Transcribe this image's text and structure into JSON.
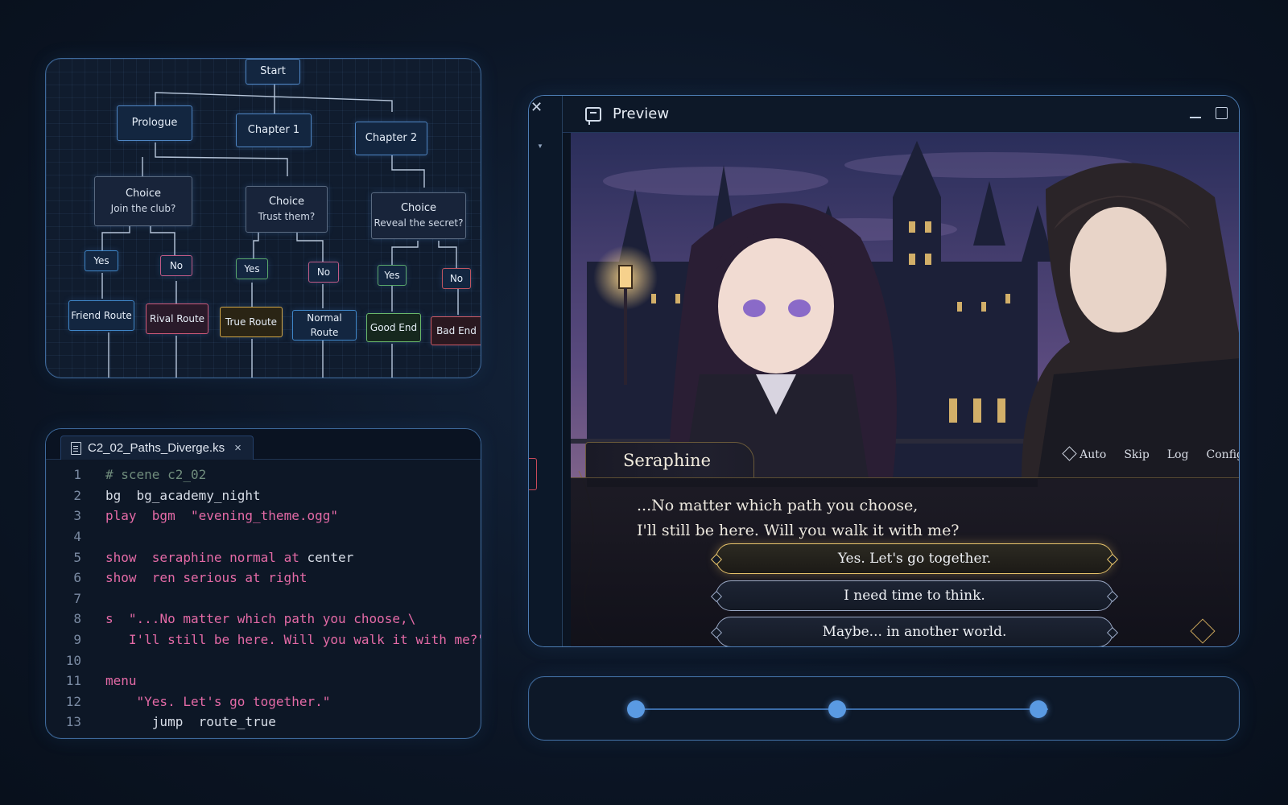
{
  "flowchart": {
    "start": "Start",
    "chapters": [
      "Prologue",
      "Chapter 1",
      "Chapter 2"
    ],
    "choices": [
      {
        "title": "Choice",
        "question": "Join the club?"
      },
      {
        "title": "Choice",
        "question": "Trust them?"
      },
      {
        "title": "Choice",
        "question": "Reveal the secret?"
      }
    ],
    "answers": [
      "Yes",
      "No",
      "Yes",
      "No",
      "Yes",
      "No"
    ],
    "routes": [
      "Friend Route",
      "Rival Route",
      "True Route",
      "Normal Route",
      "Good End",
      "Bad End"
    ]
  },
  "editor": {
    "tab_name": "C2_02_Paths_Diverge.ks",
    "close_glyph": "×",
    "lines": [
      {
        "n": "1",
        "parts": [
          [
            "c-comment",
            "# scene c2_02"
          ]
        ]
      },
      {
        "n": "2",
        "parts": [
          [
            "c-plain",
            "bg  bg_academy_night"
          ]
        ]
      },
      {
        "n": "3",
        "parts": [
          [
            "c-kw",
            "play  bgm  "
          ],
          [
            "c-str2",
            "\"evening_theme.ogg\""
          ]
        ]
      },
      {
        "n": "4",
        "parts": [
          [
            "c-plain",
            ""
          ]
        ]
      },
      {
        "n": "5",
        "parts": [
          [
            "c-kw",
            "show  "
          ],
          [
            "c-str2",
            "seraphine normal "
          ],
          [
            "c-kw",
            "at "
          ],
          [
            "c-plain",
            "center"
          ]
        ]
      },
      {
        "n": "6",
        "parts": [
          [
            "c-kw",
            "show  "
          ],
          [
            "c-str2",
            "ren serious at right"
          ]
        ]
      },
      {
        "n": "7",
        "parts": [
          [
            "c-plain",
            ""
          ]
        ]
      },
      {
        "n": "8",
        "parts": [
          [
            "c-kw",
            "s  "
          ],
          [
            "c-str2",
            "\"...No matter which path you choose,\\"
          ]
        ]
      },
      {
        "n": "9",
        "parts": [
          [
            "c-str2",
            "   I'll still be here. Will you walk it with me?\""
          ]
        ]
      },
      {
        "n": "10",
        "parts": [
          [
            "c-plain",
            ""
          ]
        ]
      },
      {
        "n": "11",
        "parts": [
          [
            "c-kw",
            "menu"
          ]
        ]
      },
      {
        "n": "12",
        "parts": [
          [
            "c-str2",
            "    \"Yes. Let's go together.\""
          ]
        ]
      },
      {
        "n": "13",
        "parts": [
          [
            "c-plain",
            "      jump  route_true"
          ]
        ]
      }
    ]
  },
  "preview": {
    "title": "Preview",
    "speaker": "Seraphine",
    "dialogue_line1": "...No matter which path you choose,",
    "dialogue_line2": "I'll still be here. Will you walk it with me?",
    "menu": {
      "auto": "Auto",
      "skip": "Skip",
      "log": "Log",
      "config": "Config"
    },
    "choices": [
      "Yes. Let's go together.",
      "I need time to think.",
      "Maybe... in another world."
    ],
    "selected_choice": 0
  },
  "timeline": {
    "points": 3,
    "active_index": 1
  }
}
